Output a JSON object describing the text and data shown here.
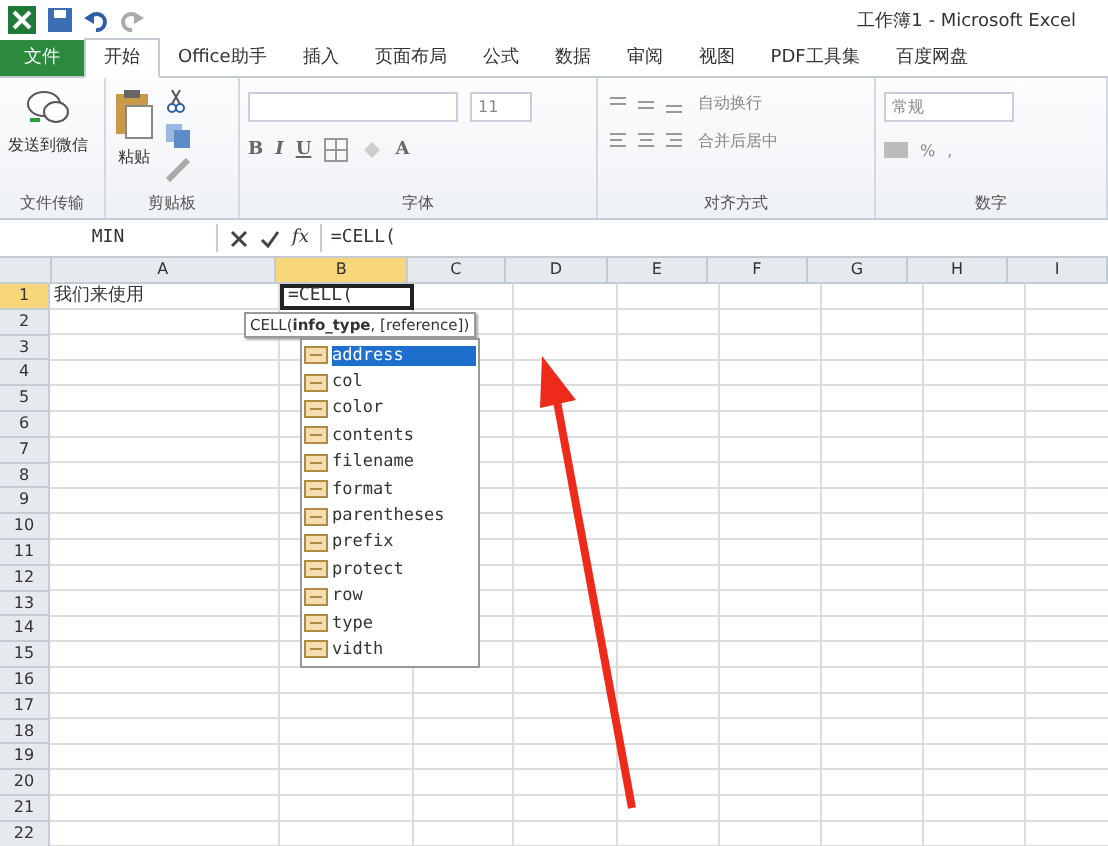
{
  "window": {
    "title": "工作簿1 - Microsoft Excel"
  },
  "tabs": [
    {
      "label": "文件",
      "kind": "file",
      "selected": false
    },
    {
      "label": "开始",
      "kind": "tab",
      "selected": true
    },
    {
      "label": "Office助手",
      "kind": "tab",
      "selected": false
    },
    {
      "label": "插入",
      "kind": "tab",
      "selected": false
    },
    {
      "label": "页面布局",
      "kind": "tab",
      "selected": false
    },
    {
      "label": "公式",
      "kind": "tab",
      "selected": false
    },
    {
      "label": "数据",
      "kind": "tab",
      "selected": false
    },
    {
      "label": "审阅",
      "kind": "tab",
      "selected": false
    },
    {
      "label": "视图",
      "kind": "tab",
      "selected": false
    },
    {
      "label": "PDF工具集",
      "kind": "tab",
      "selected": false
    },
    {
      "label": "百度网盘",
      "kind": "tab",
      "selected": false
    }
  ],
  "ribbon": {
    "groups": [
      {
        "label": "文件传输",
        "kind": "wechat",
        "button": "发送到微信"
      },
      {
        "label": "剪贴板",
        "kind": "clipboard",
        "button": "粘贴"
      },
      {
        "label": "字体",
        "kind": "font",
        "font_size": "11",
        "styles": [
          "B",
          "I",
          "U"
        ],
        "color_button": "A"
      },
      {
        "label": "对齐方式",
        "kind": "align",
        "wrap": "自动换行",
        "merge": "合并后居中"
      },
      {
        "label": "数字",
        "kind": "number",
        "format": "常规",
        "percent": "%",
        "comma": ","
      }
    ]
  },
  "formula_bar": {
    "name_box": "MIN",
    "function_label": "fx",
    "formula": "=CELL("
  },
  "sheet": {
    "columns": [
      "A",
      "B",
      "C",
      "D",
      "E",
      "F",
      "G",
      "H",
      "I"
    ],
    "rows": [
      {
        "label": "1",
        "cells": [
          {
            "value": "我们来使用",
            "selected": false
          },
          {
            "value": "=CELL(",
            "selected": true
          }
        ]
      },
      {
        "label": "2"
      },
      {
        "label": "3"
      },
      {
        "label": "4"
      },
      {
        "label": "5"
      },
      {
        "label": "6"
      },
      {
        "label": "7"
      },
      {
        "label": "8"
      },
      {
        "label": "9"
      },
      {
        "label": "10"
      },
      {
        "label": "11"
      },
      {
        "label": "12"
      },
      {
        "label": "13"
      },
      {
        "label": "14"
      },
      {
        "label": "15"
      },
      {
        "label": "16"
      },
      {
        "label": "17"
      },
      {
        "label": "18"
      },
      {
        "label": "19"
      },
      {
        "label": "20"
      },
      {
        "label": "21"
      },
      {
        "label": "22"
      }
    ]
  },
  "tooltip": "CELL(**info_type**, [reference])",
  "autocomplete": [
    {
      "label": "address",
      "selected": true
    },
    {
      "label": "col",
      "selected": false
    },
    {
      "label": "color",
      "selected": false
    },
    {
      "label": "contents",
      "selected": false
    },
    {
      "label": "filename",
      "selected": false
    },
    {
      "label": "format",
      "selected": false
    },
    {
      "label": "parentheses",
      "selected": false
    },
    {
      "label": "prefix",
      "selected": false
    },
    {
      "label": "protect",
      "selected": false
    },
    {
      "label": "row",
      "selected": false
    },
    {
      "label": "type",
      "selected": false
    },
    {
      "label": "vidth",
      "selected": false
    }
  ]
}
